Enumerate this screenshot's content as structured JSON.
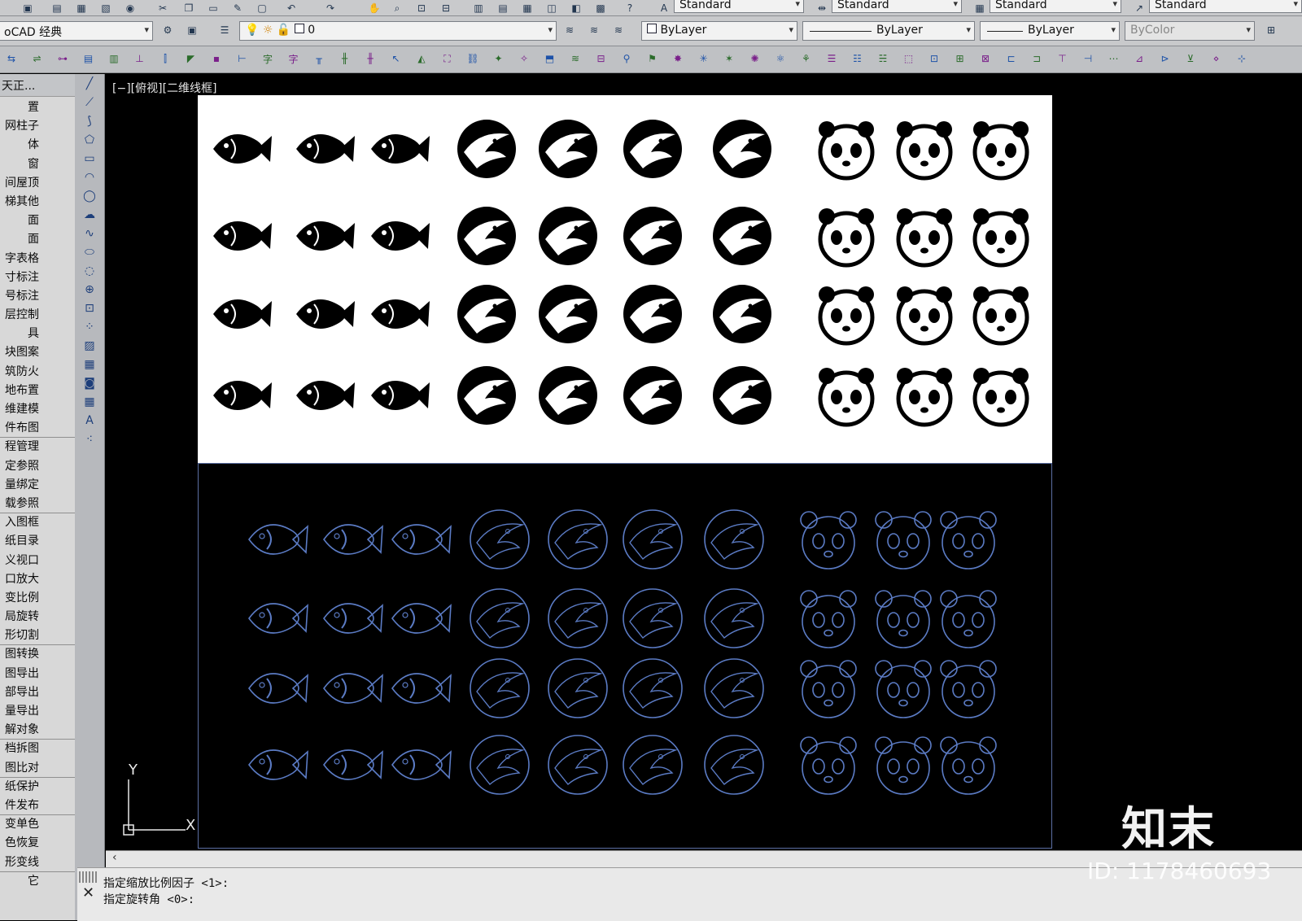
{
  "toolbar_top": {
    "style_text": "Standard",
    "dim_style": "Standard",
    "table_style": "Standard",
    "multileader_style": "Standard"
  },
  "toolbar_second": {
    "workspace": "oCAD 经典",
    "layer_name": "0",
    "color": "ByLayer",
    "linetype": "ByLayer",
    "lineweight": "ByLayer",
    "plotstyle": "ByColor"
  },
  "sidebar": {
    "header": "天正...",
    "items": [
      "置",
      "网柱子",
      "体",
      "窗",
      "间屋顶",
      "梯其他",
      "面",
      "面",
      "字表格",
      "寸标注",
      "号标注",
      "层控制",
      "具",
      "块图案",
      "筑防火",
      "地布置",
      "维建模",
      "件布图",
      "程管理",
      "定参照",
      "量绑定",
      "载参照",
      "入图框",
      "纸目录",
      "义视口",
      "口放大",
      "变比例",
      "局旋转",
      "形切割",
      "图转换",
      "图导出",
      "部导出",
      "量导出",
      "解对象",
      "档拆图",
      "图比对",
      "纸保护",
      "件发布",
      "变单色",
      "色恢复",
      "形变线",
      "它"
    ]
  },
  "viewport": {
    "label": "[−][俯视][二维线框]",
    "ucs_y": "Y",
    "ucs_x": "X"
  },
  "command": {
    "line1": "指定缩放比例因子 <1>:",
    "line2": "指定旋转角 <0>:"
  },
  "overlay": {
    "brand": "知末",
    "id_text": "ID: 1178460693"
  },
  "colors": {
    "viewport_bg": "#000000",
    "outline_blue": "#5b7bc4",
    "panel_white": "#ffffff"
  }
}
